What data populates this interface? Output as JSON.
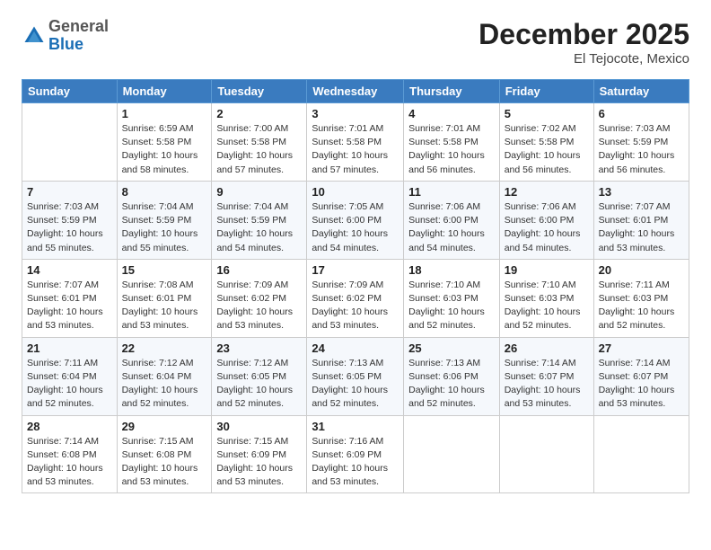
{
  "logo": {
    "general": "General",
    "blue": "Blue"
  },
  "header": {
    "month": "December 2025",
    "location": "El Tejocote, Mexico"
  },
  "weekdays": [
    "Sunday",
    "Monday",
    "Tuesday",
    "Wednesday",
    "Thursday",
    "Friday",
    "Saturday"
  ],
  "weeks": [
    [
      {
        "day": "",
        "info": ""
      },
      {
        "day": "1",
        "info": "Sunrise: 6:59 AM\nSunset: 5:58 PM\nDaylight: 10 hours\nand 58 minutes."
      },
      {
        "day": "2",
        "info": "Sunrise: 7:00 AM\nSunset: 5:58 PM\nDaylight: 10 hours\nand 57 minutes."
      },
      {
        "day": "3",
        "info": "Sunrise: 7:01 AM\nSunset: 5:58 PM\nDaylight: 10 hours\nand 57 minutes."
      },
      {
        "day": "4",
        "info": "Sunrise: 7:01 AM\nSunset: 5:58 PM\nDaylight: 10 hours\nand 56 minutes."
      },
      {
        "day": "5",
        "info": "Sunrise: 7:02 AM\nSunset: 5:58 PM\nDaylight: 10 hours\nand 56 minutes."
      },
      {
        "day": "6",
        "info": "Sunrise: 7:03 AM\nSunset: 5:59 PM\nDaylight: 10 hours\nand 56 minutes."
      }
    ],
    [
      {
        "day": "7",
        "info": "Sunrise: 7:03 AM\nSunset: 5:59 PM\nDaylight: 10 hours\nand 55 minutes."
      },
      {
        "day": "8",
        "info": "Sunrise: 7:04 AM\nSunset: 5:59 PM\nDaylight: 10 hours\nand 55 minutes."
      },
      {
        "day": "9",
        "info": "Sunrise: 7:04 AM\nSunset: 5:59 PM\nDaylight: 10 hours\nand 54 minutes."
      },
      {
        "day": "10",
        "info": "Sunrise: 7:05 AM\nSunset: 6:00 PM\nDaylight: 10 hours\nand 54 minutes."
      },
      {
        "day": "11",
        "info": "Sunrise: 7:06 AM\nSunset: 6:00 PM\nDaylight: 10 hours\nand 54 minutes."
      },
      {
        "day": "12",
        "info": "Sunrise: 7:06 AM\nSunset: 6:00 PM\nDaylight: 10 hours\nand 54 minutes."
      },
      {
        "day": "13",
        "info": "Sunrise: 7:07 AM\nSunset: 6:01 PM\nDaylight: 10 hours\nand 53 minutes."
      }
    ],
    [
      {
        "day": "14",
        "info": "Sunrise: 7:07 AM\nSunset: 6:01 PM\nDaylight: 10 hours\nand 53 minutes."
      },
      {
        "day": "15",
        "info": "Sunrise: 7:08 AM\nSunset: 6:01 PM\nDaylight: 10 hours\nand 53 minutes."
      },
      {
        "day": "16",
        "info": "Sunrise: 7:09 AM\nSunset: 6:02 PM\nDaylight: 10 hours\nand 53 minutes."
      },
      {
        "day": "17",
        "info": "Sunrise: 7:09 AM\nSunset: 6:02 PM\nDaylight: 10 hours\nand 53 minutes."
      },
      {
        "day": "18",
        "info": "Sunrise: 7:10 AM\nSunset: 6:03 PM\nDaylight: 10 hours\nand 52 minutes."
      },
      {
        "day": "19",
        "info": "Sunrise: 7:10 AM\nSunset: 6:03 PM\nDaylight: 10 hours\nand 52 minutes."
      },
      {
        "day": "20",
        "info": "Sunrise: 7:11 AM\nSunset: 6:03 PM\nDaylight: 10 hours\nand 52 minutes."
      }
    ],
    [
      {
        "day": "21",
        "info": "Sunrise: 7:11 AM\nSunset: 6:04 PM\nDaylight: 10 hours\nand 52 minutes."
      },
      {
        "day": "22",
        "info": "Sunrise: 7:12 AM\nSunset: 6:04 PM\nDaylight: 10 hours\nand 52 minutes."
      },
      {
        "day": "23",
        "info": "Sunrise: 7:12 AM\nSunset: 6:05 PM\nDaylight: 10 hours\nand 52 minutes."
      },
      {
        "day": "24",
        "info": "Sunrise: 7:13 AM\nSunset: 6:05 PM\nDaylight: 10 hours\nand 52 minutes."
      },
      {
        "day": "25",
        "info": "Sunrise: 7:13 AM\nSunset: 6:06 PM\nDaylight: 10 hours\nand 52 minutes."
      },
      {
        "day": "26",
        "info": "Sunrise: 7:14 AM\nSunset: 6:07 PM\nDaylight: 10 hours\nand 53 minutes."
      },
      {
        "day": "27",
        "info": "Sunrise: 7:14 AM\nSunset: 6:07 PM\nDaylight: 10 hours\nand 53 minutes."
      }
    ],
    [
      {
        "day": "28",
        "info": "Sunrise: 7:14 AM\nSunset: 6:08 PM\nDaylight: 10 hours\nand 53 minutes."
      },
      {
        "day": "29",
        "info": "Sunrise: 7:15 AM\nSunset: 6:08 PM\nDaylight: 10 hours\nand 53 minutes."
      },
      {
        "day": "30",
        "info": "Sunrise: 7:15 AM\nSunset: 6:09 PM\nDaylight: 10 hours\nand 53 minutes."
      },
      {
        "day": "31",
        "info": "Sunrise: 7:16 AM\nSunset: 6:09 PM\nDaylight: 10 hours\nand 53 minutes."
      },
      {
        "day": "",
        "info": ""
      },
      {
        "day": "",
        "info": ""
      },
      {
        "day": "",
        "info": ""
      }
    ]
  ]
}
